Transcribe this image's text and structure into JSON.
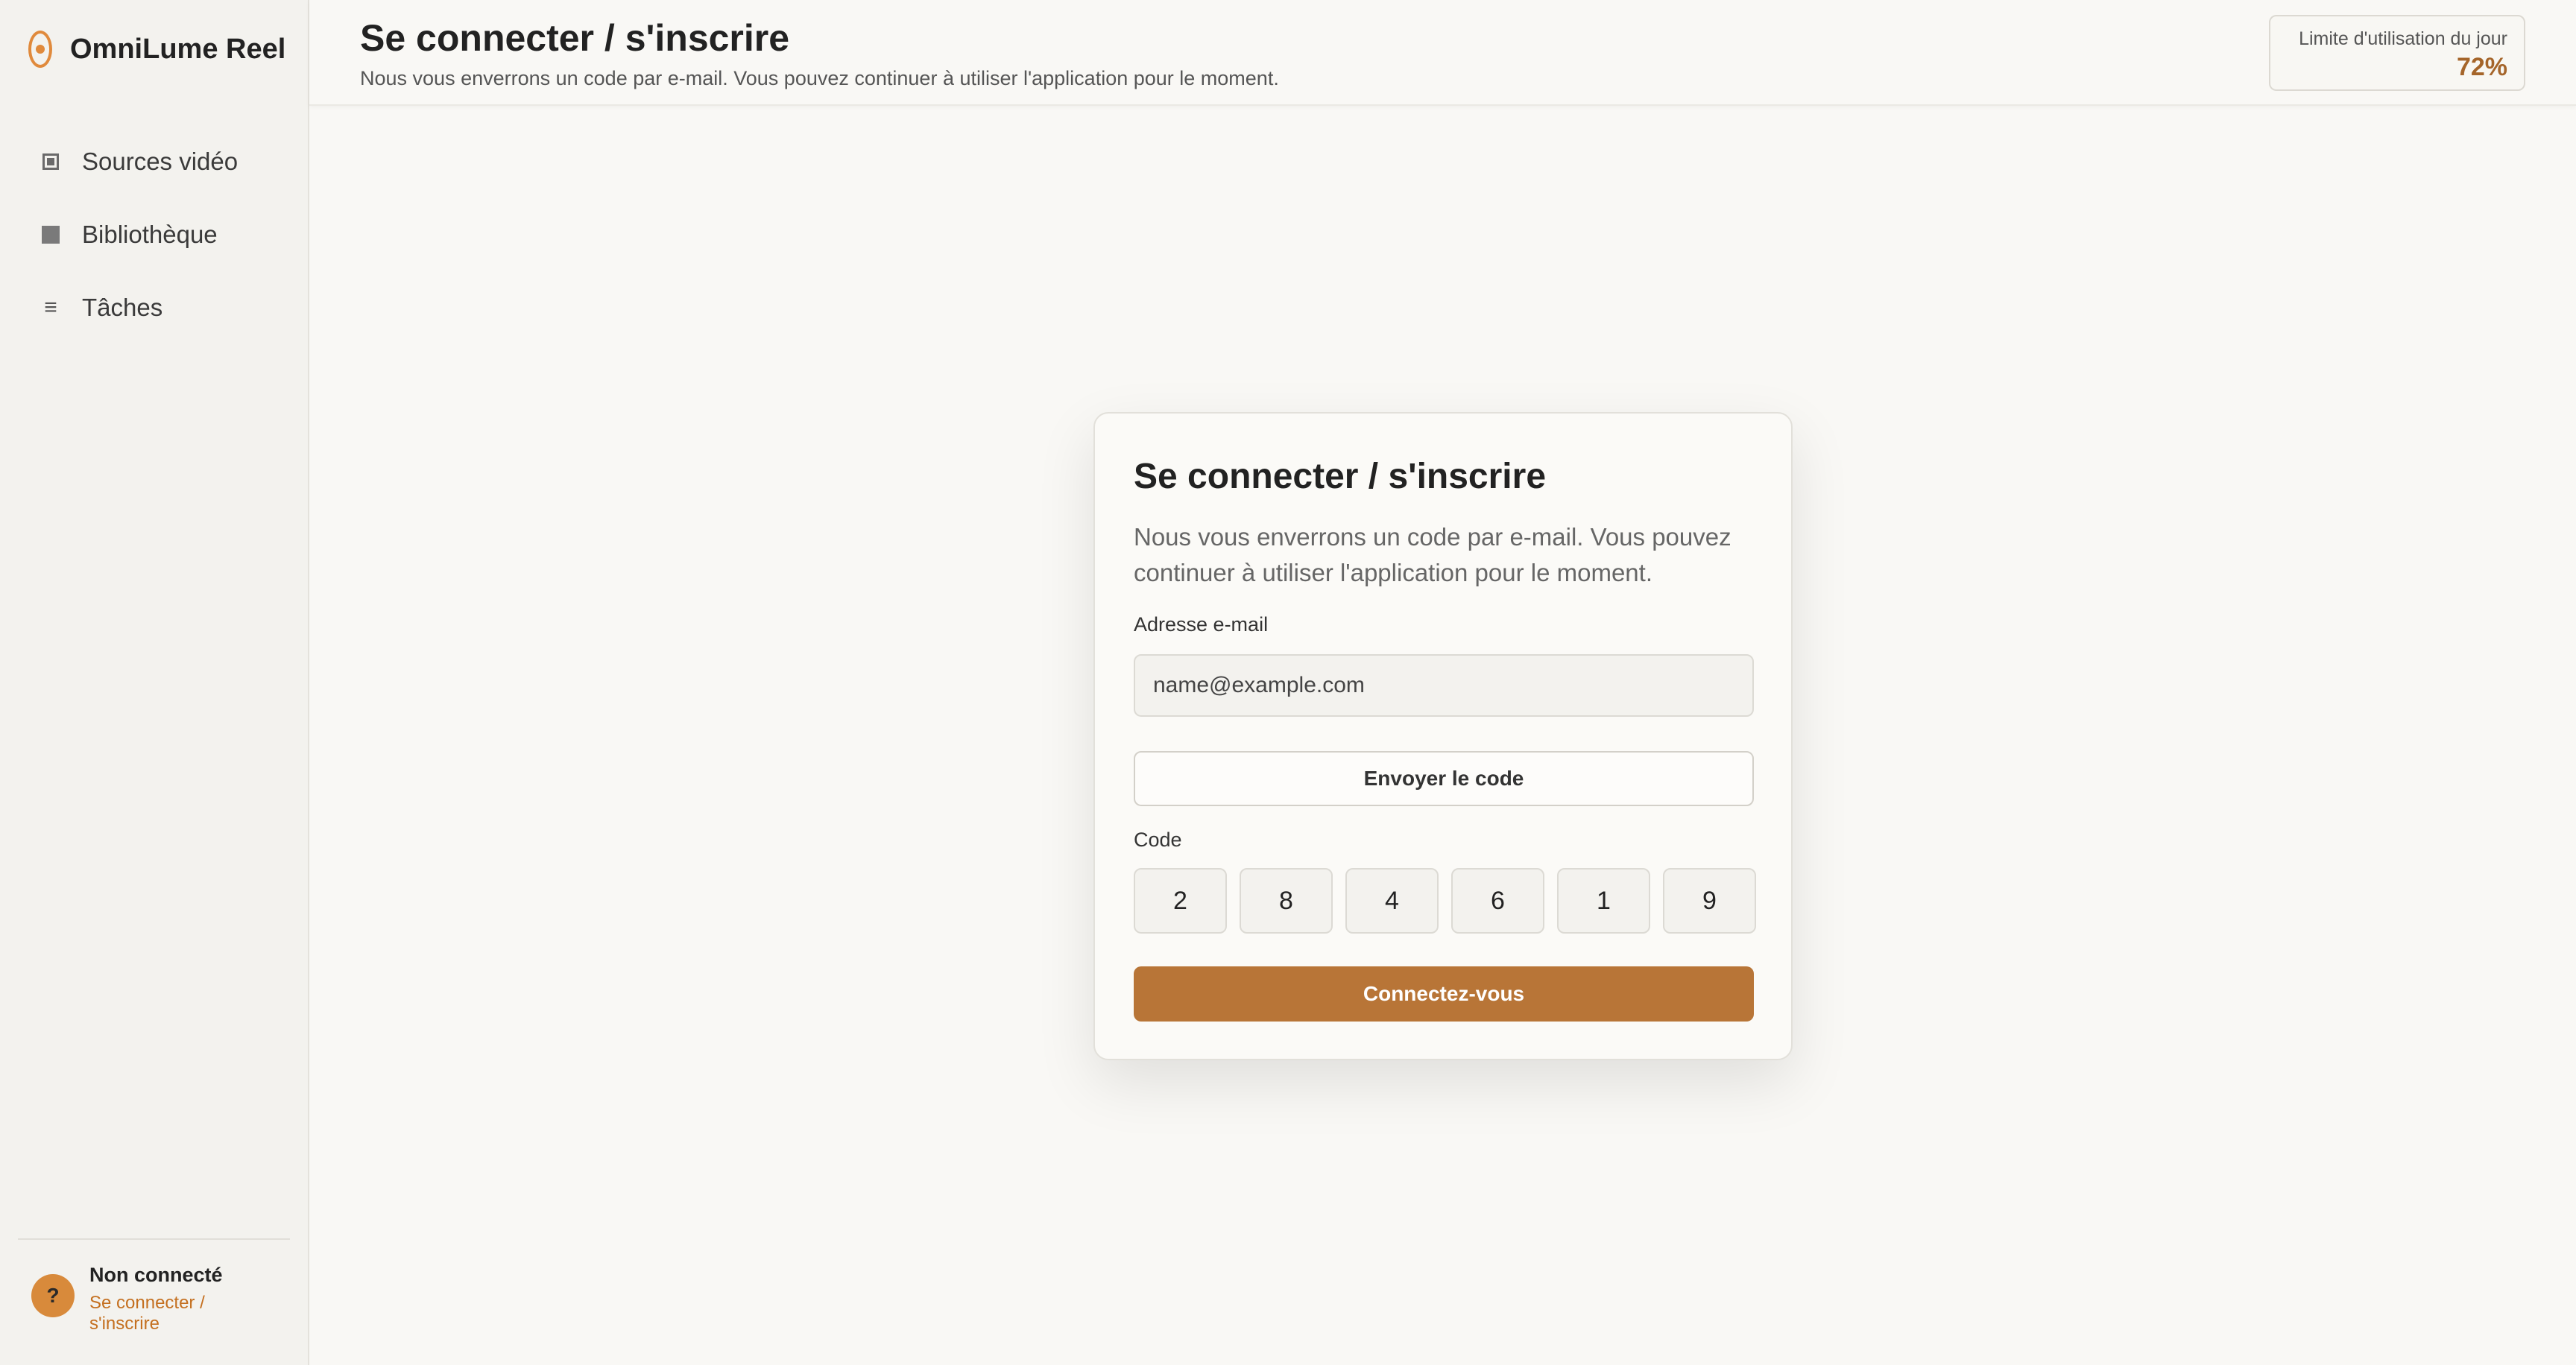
{
  "app": {
    "name": "OmniLume Reel"
  },
  "sidebar": {
    "items": [
      {
        "label": "Sources vidéo",
        "icon": "video-source-icon"
      },
      {
        "label": "Bibliothèque",
        "icon": "library-icon"
      },
      {
        "label": "Tâches",
        "icon": "tasks-icon"
      }
    ],
    "user": {
      "avatar_glyph": "?",
      "status": "Non connecté",
      "link": "Se connecter / s'inscrire"
    }
  },
  "header": {
    "title": "Se connecter / s'inscrire",
    "subtitle": "Nous vous enverrons un code par e-mail. Vous pouvez continuer à utiliser l'application pour le moment.",
    "usage": {
      "label": "Limite d'utilisation du jour",
      "value": "72%"
    }
  },
  "card": {
    "title": "Se connecter / s'inscrire",
    "description": "Nous vous enverrons un code par e-mail. Vous pouvez continuer à utiliser l'application pour le moment.",
    "email_label": "Adresse e-mail",
    "email_placeholder": "name@example.com",
    "email_value": "",
    "send_button": "Envoyer le code",
    "code_label": "Code",
    "code_digits": [
      "2",
      "8",
      "4",
      "6",
      "1",
      "9"
    ],
    "login_button": "Connectez-vous"
  },
  "colors": {
    "accent": "#b87537",
    "brand": "#e08a3c",
    "link": "#c46f1f",
    "usage_value": "#a5652a"
  }
}
